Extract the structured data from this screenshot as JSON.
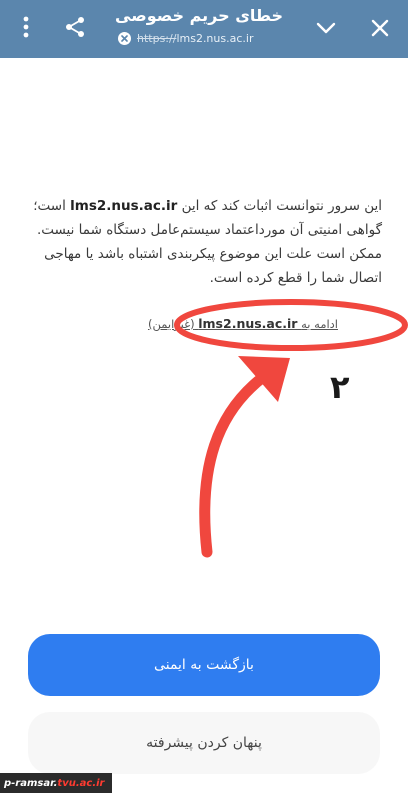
{
  "header": {
    "title": "خطای حریم خصوصی",
    "url_protocol": "https://",
    "url_host": "lms2.nus.ac.ir",
    "icons": [
      "close-icon",
      "chevron-down-icon",
      "share-icon",
      "more-vert-icon"
    ]
  },
  "message": {
    "line1_pre": "این سرور نتوانست اثبات کند که این",
    "host": "lms2.nus.ac.ir",
    "line1_post": "است؛",
    "line2": "گواهی امنیتی آن مورداعتماد سیستم‌عامل دستگاه شما نیست.",
    "line3": "ممکن است علت این موضوع پیکربندی اشتباه باشد یا مهاجی",
    "line4": "اتصال شما را قطع کرده است."
  },
  "proceed": {
    "prefix": "ادامه به",
    "host": "lms2.nus.ac.ir",
    "suffix": "(غیرایمن)"
  },
  "annotation": {
    "number": "۲",
    "color": "#f0473e"
  },
  "buttons": {
    "back_to_safety": "بازگشت به ایمنی",
    "hide_advanced": "پنهان کردن پیشرفته"
  },
  "watermark": {
    "text": "p-ramsar.",
    "accent": "tvu.ac.ir"
  },
  "colors": {
    "topbar": "#5b86ad",
    "primary": "#2f7df0"
  }
}
